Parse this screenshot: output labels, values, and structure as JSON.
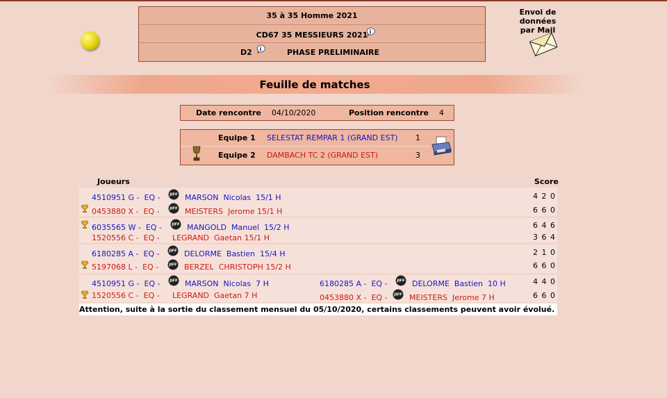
{
  "header": {
    "title_line1": "35  à 35  Homme  2021",
    "title_line2": "CD67 35 MESSIEURS 2021",
    "division": "D2",
    "phase": "PHASE PRELIMINAIRE"
  },
  "mail": {
    "line1": "Envoi de données",
    "line2": "par Mail"
  },
  "banner": {
    "title": "Feuille de matches"
  },
  "meeting": {
    "date_label": "Date rencontre",
    "date_value": "04/10/2020",
    "position_label": "Position rencontre",
    "position_value": "4"
  },
  "teams": [
    {
      "label": "Equipe 1",
      "name": "SELESTAT REMPAR 1 (GRAND EST)",
      "score": "1"
    },
    {
      "label": "Equipe 2",
      "name": "DAMBACH TC 2 (GRAND EST)",
      "score": "3"
    }
  ],
  "results": {
    "players_header": "Joueurs",
    "score_header": "Score",
    "matches": [
      {
        "p1": "4510951 G -  EQ -",
        "p1name": "MARSON  Nicolas  15/1 H",
        "s1": "4 2 0",
        "p2": "0453880 X -  EQ -",
        "p2name": "MEISTERS  Jerome 15/1 H",
        "s2": "6 6 0"
      },
      {
        "p1": "6035565 W -  EQ -",
        "p1name": "MANGOLD  Manuel  15/2 H",
        "s1": "6 4 6",
        "p2": "1520556 C -  EQ -",
        "p2name": "LEGRAND  Gaetan 15/1 H",
        "s2": "3 6 4"
      },
      {
        "p1": "6180285 A -  EQ -",
        "p1name": "DELORME  Bastien  15/4 H",
        "s1": "2 1 0",
        "p2": "5197068 L -  EQ -",
        "p2name": "BERZEL  CHRISTOPH 15/2 H",
        "s2": "6 6 0"
      },
      {
        "p1": "4510951 G -  EQ -",
        "p1name": "MARSON  Nicolas  7 H",
        "p1b": "6180285 A -  EQ -",
        "p1bname": "DELORME  Bastien  10 H",
        "s1": "4 4 0",
        "p2": "1520556 C -  EQ -",
        "p2name": "LEGRAND  Gaetan 7 H",
        "p2b": "0453880 X -  EQ -",
        "p2bname": "MEISTERS  Jerome 7 H",
        "s2": "6 6 0"
      }
    ],
    "warning": "Attention, suite à la sortie du classement mensuel du 05/10/2020, certains classements peuvent avoir évolué."
  },
  "icons": {
    "ball": "tennis-ball-icon",
    "mail": "envelope-icon",
    "info": "info-icon",
    "printer": "printer-icon",
    "trophy": "trophy-icon",
    "club": "club-logo-icon"
  },
  "colors": {
    "team1": "#1515c8",
    "team2": "#cc1a10",
    "header_bg": "#e8b39c",
    "box_bg": "#efb7a0"
  }
}
